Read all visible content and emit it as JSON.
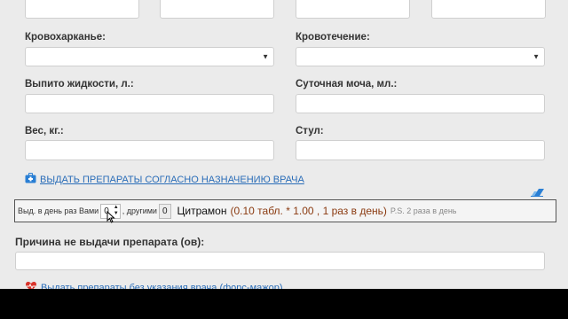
{
  "fields": {
    "hemoptysis_label": "Кровохарканье:",
    "hemoptysis_value": "",
    "bleeding_label": "Кровотечение:",
    "bleeding_value": "",
    "fluid_label": "Выпито жидкости, л.:",
    "fluid_value": "",
    "urine_label": "Суточная моча, мл.:",
    "urine_value": "",
    "weight_label": "Вес, кг.:",
    "weight_value": "",
    "stool_label": "Стул:",
    "stool_value": ""
  },
  "actions": {
    "issue_prescribed_link": "ВЫДАТЬ ПРЕПАРАТЫ СОГЛАСНО НАЗНАЧЕНИЮ ВРАЧА",
    "issue_without_doctor_link": "Выдать препараты без указания врача (форс-мажор)"
  },
  "medication": {
    "issued_by_you_label": "Выд. в день раз Вами",
    "issued_by_you_value": "0",
    "issued_by_others_label": ", другими",
    "issued_by_others_value": "0",
    "drug_name": "Цитрамон",
    "dosage": "(0.10 табл. * 1.00 , 1 раз в день)",
    "note": "P.S. 2 раза в день"
  },
  "reason": {
    "label": "Причина не выдачи препарата (ов):",
    "value": ""
  },
  "icons": {
    "medkit": "medkit-icon",
    "eraser": "eraser-icon",
    "heartbeat": "heartbeat-icon"
  },
  "colors": {
    "link": "#2a6db8",
    "heart": "#d9342b",
    "eraser": "#2a7fd4",
    "dose": "#8a3a10"
  }
}
